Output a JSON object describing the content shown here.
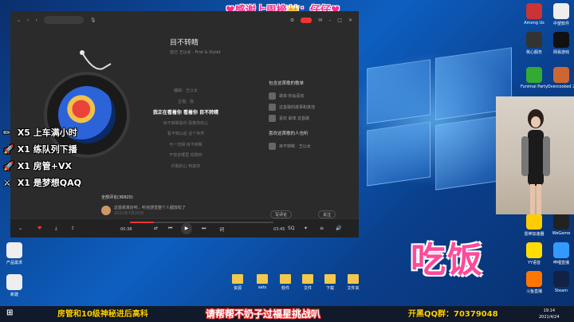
{
  "banner": {
    "thanks": "♥感谢上周榜👑：仔仔♥"
  },
  "player": {
    "title": "目不转睛",
    "artist": "自己 王以太 - First & Stylet",
    "lyrics": [
      "编曲：王以太",
      "主唱：我",
      "我正在看着你 看着你 目不转睛",
      "目不转睛看你 看着你的心",
      "看不到以后 这个世界",
      "与一切相 目不转睛",
      "不管去哪里 追随你",
      "问我的心 到底你"
    ],
    "current_lyric_index": 2,
    "side_header": "包含这首歌的歌单",
    "side_items": [
      "歌单·你会喜欢",
      "这首歌的故事和其他",
      "喜欢 歌单 这首歌"
    ],
    "side_header2": "喜欢这首歌的人也听",
    "side_items2": [
      "目不转睛 · 王以太"
    ],
    "comments_header": "全部评论(36820)",
    "comment_text": "这首歌真好听，听完感觉整个人都放松了",
    "comment_time": "2021年7月20日",
    "btn_write": "写评论",
    "btn_follow": "关注",
    "time_current": "00:38",
    "time_total": "03:45"
  },
  "gifts": [
    {
      "icon": "✏",
      "text": "X5  上车满小时"
    },
    {
      "icon": "🚀",
      "text": "X1  练队列下播"
    },
    {
      "icon": "🚀",
      "text": "X1  房管+VX"
    },
    {
      "icon": "⚔",
      "text": "X1  是梦想QAQ"
    }
  ],
  "overlay_text": "吃饭",
  "desktop_icons_right": [
    {
      "label": "Among Us",
      "color": "#c33"
    },
    {
      "label": "中望软件",
      "color": "#eee"
    },
    {
      "label": "核心服务",
      "color": "#333"
    },
    {
      "label": "网易游戏",
      "color": "#111"
    },
    {
      "label": "Funimal Party",
      "color": "#3a3"
    },
    {
      "label": "Overcooked 2",
      "color": "#c63"
    },
    {
      "label": "雷神加速器",
      "color": "#fc0"
    },
    {
      "label": "WeGame",
      "color": "#222"
    },
    {
      "label": "YY语音",
      "color": "#fd0"
    },
    {
      "label": "哔哩直播",
      "color": "#39f"
    },
    {
      "label": "斗鱼直播",
      "color": "#f70"
    },
    {
      "label": "Steam",
      "color": "#124"
    }
  ],
  "desktop_icons_left": [
    {
      "label": "产品需求",
      "color": "#eee"
    },
    {
      "label": "新建",
      "color": "#eee"
    }
  ],
  "folders": [
    "资源",
    "sets",
    "软件",
    "文件",
    "下载",
    "文件夹"
  ],
  "taskbar": {
    "left_text": "房管和10级神秘进后高科",
    "center_text": "请帮帮不奶子过福星挑战叭",
    "right_text": "开黑QQ群：70379048",
    "clock_time": "19:14",
    "clock_date": "2021/4/24"
  }
}
